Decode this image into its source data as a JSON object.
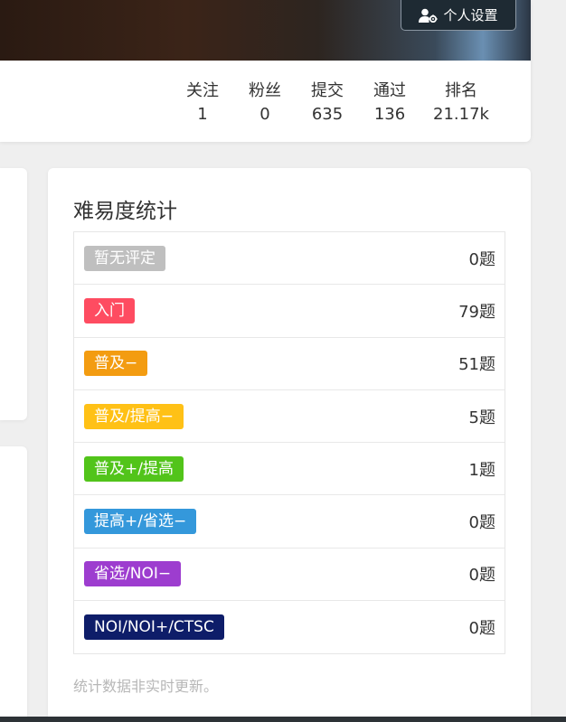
{
  "header": {
    "settings_button": "个人设置",
    "settings_icon": "user-gear-icon"
  },
  "stats": [
    {
      "label": "关注",
      "value": "1"
    },
    {
      "label": "粉丝",
      "value": "0"
    },
    {
      "label": "提交",
      "value": "635"
    },
    {
      "label": "通过",
      "value": "136"
    },
    {
      "label": "排名",
      "value": "21.17k"
    }
  ],
  "difficulty": {
    "title": "难易度统计",
    "rows": [
      {
        "label": "暂无评定",
        "count": "0题",
        "color": "#bfbfbf"
      },
      {
        "label": "入门",
        "count": "79题",
        "color": "#fe4c61"
      },
      {
        "label": "普及−",
        "count": "51题",
        "color": "#f39c11"
      },
      {
        "label": "普及/提高−",
        "count": "5题",
        "color": "#ffc116"
      },
      {
        "label": "普及+/提高",
        "count": "1题",
        "color": "#52c41a"
      },
      {
        "label": "提高+/省选−",
        "count": "0题",
        "color": "#3498db"
      },
      {
        "label": "省选/NOI−",
        "count": "0题",
        "color": "#9d3dcf"
      },
      {
        "label": "NOI/NOI+/CTSC",
        "count": "0题",
        "color": "#0e1d69"
      }
    ],
    "note": "统计数据非实时更新。"
  }
}
